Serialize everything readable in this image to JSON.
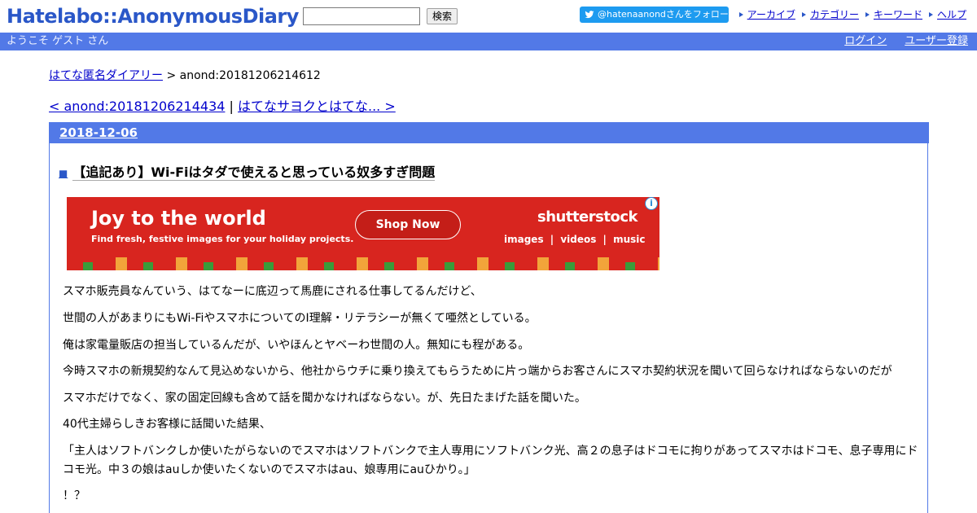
{
  "header": {
    "logo": "Hatelabo::AnonymousDiary",
    "search_value": "",
    "search_button": "検索",
    "follow_button": "@hatenaanondさんをフォロー",
    "links": [
      "アーカイブ",
      "カテゴリー",
      "キーワード",
      "ヘルプ"
    ]
  },
  "bar": {
    "welcome": "ようこそ ゲスト さん",
    "login": "ログイン",
    "register": "ユーザー登録"
  },
  "breadcrumb": {
    "home": "はてな匿名ダイアリー",
    "sep": " > ",
    "current": "anond:20181206214612"
  },
  "pager": {
    "prev": "< anond:20181206214434",
    "sep": " | ",
    "next": "はてなサヨクとはてな... >"
  },
  "entry": {
    "date": "2018-12-06",
    "square": "■",
    "title": "【追記あり】Wi-Fiはタダで使えると思っている奴多すぎ問題",
    "paragraphs": [
      "スマホ販売員なんていう、はてなーに底辺って馬鹿にされる仕事してるんだけど、",
      "世間の人があまりにもWi-FiやスマホについてのI理解・リテラシーが無くて唖然としている。",
      "俺は家電量販店の担当しているんだが、いやほんとヤベーわ世間の人。無知にも程がある。",
      "今時スマホの新規契約なんて見込めないから、他社からウチに乗り換えてもらうために片っ端からお客さんにスマホ契約状況を聞いて回らなければならないのだが",
      "スマホだけでなく、家の固定回線も含めて話を聞かなければならない。が、先日たまげた話を聞いた。",
      "40代主婦らしきお客様に話聞いた結果、",
      "「主人はソフトバンクしか使いたがらないのでスマホはソフトバンクで主人専用にソフトバンク光、高２の息子はドコモに拘りがあってスマホはドコモ、息子専用にド",
      "コモ光。中３の娘はauしか使いたくないのでスマホはau、娘専用にauひかり。」",
      "！？"
    ]
  },
  "ad": {
    "headline": "Joy to the world",
    "sub": "Find fresh, festive images for your holiday projects.",
    "button": "Shop Now",
    "brand": "shutterstock",
    "menu": "images  |  videos  |  music",
    "info": "i"
  },
  "colors": {
    "brand_blue": "#5279e7",
    "logo_blue": "#2a57c8",
    "ad_red": "#d8251f",
    "twitter": "#1d9bf0"
  }
}
